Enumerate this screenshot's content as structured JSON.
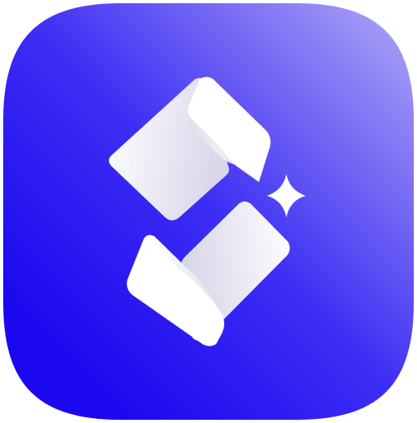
{
  "app_icon": {
    "icon": "folded-cards-sparkle-logo",
    "colors": {
      "background_deep": "#1c08ef",
      "background_mid": "#3d2ef4",
      "background_light": "#a59cf5",
      "card_white": "#ffffff",
      "card_shadow": "#d8d6ea",
      "sparkle": "#ffffff"
    }
  }
}
